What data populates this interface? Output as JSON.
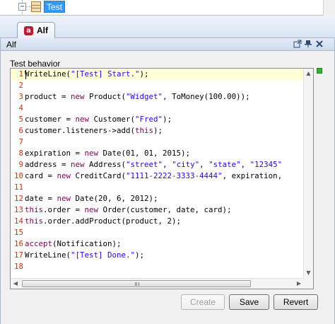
{
  "tree": {
    "expander_symbol": "−",
    "selected_node": "Test"
  },
  "tab": {
    "icon_letter": "a",
    "label": "Alf"
  },
  "panel": {
    "title": "Alf",
    "section_label": "Test behavior"
  },
  "code_lines": [
    {
      "n": "1",
      "parts": [
        [
          "src",
          "WriteLine("
        ],
        [
          "str",
          "\"[Test] Start.\""
        ],
        [
          "src",
          ");"
        ]
      ]
    },
    {
      "n": "2",
      "parts": []
    },
    {
      "n": "3",
      "parts": [
        [
          "src",
          "product = "
        ],
        [
          "kw",
          "new"
        ],
        [
          "src",
          " Product("
        ],
        [
          "str",
          "\"Widget\""
        ],
        [
          "src",
          ", ToMoney(100.00));"
        ]
      ]
    },
    {
      "n": "4",
      "parts": []
    },
    {
      "n": "5",
      "parts": [
        [
          "src",
          "customer = "
        ],
        [
          "kw",
          "new"
        ],
        [
          "src",
          " Customer("
        ],
        [
          "str",
          "\"Fred\""
        ],
        [
          "src",
          ");"
        ]
      ]
    },
    {
      "n": "6",
      "parts": [
        [
          "src",
          "customer.listeners->add("
        ],
        [
          "kw",
          "this"
        ],
        [
          "src",
          ");"
        ]
      ]
    },
    {
      "n": "7",
      "parts": []
    },
    {
      "n": "8",
      "parts": [
        [
          "src",
          "expiration = "
        ],
        [
          "kw",
          "new"
        ],
        [
          "src",
          " Date(01, 01, 2015);"
        ]
      ]
    },
    {
      "n": "9",
      "parts": [
        [
          "src",
          "address = "
        ],
        [
          "kw",
          "new"
        ],
        [
          "src",
          " Address("
        ],
        [
          "str",
          "\"street\""
        ],
        [
          "src",
          ", "
        ],
        [
          "str",
          "\"city\""
        ],
        [
          "src",
          ", "
        ],
        [
          "str",
          "\"state\""
        ],
        [
          "src",
          ", "
        ],
        [
          "str",
          "\"12345\""
        ]
      ]
    },
    {
      "n": "10",
      "parts": [
        [
          "src",
          "card = "
        ],
        [
          "kw",
          "new"
        ],
        [
          "src",
          " CreditCard("
        ],
        [
          "str",
          "\"1111-2222-3333-4444\""
        ],
        [
          "src",
          ", expiration,"
        ]
      ]
    },
    {
      "n": "11",
      "parts": []
    },
    {
      "n": "12",
      "parts": [
        [
          "src",
          "date = "
        ],
        [
          "kw",
          "new"
        ],
        [
          "src",
          " Date(20, 6, 2012);"
        ]
      ]
    },
    {
      "n": "13",
      "parts": [
        [
          "kw",
          "this"
        ],
        [
          "src",
          ".order = "
        ],
        [
          "kw",
          "new"
        ],
        [
          "src",
          " Order(customer, date, card);"
        ]
      ]
    },
    {
      "n": "14",
      "parts": [
        [
          "kw",
          "this"
        ],
        [
          "src",
          ".order.addProduct(product, 2);"
        ]
      ]
    },
    {
      "n": "15",
      "parts": []
    },
    {
      "n": "16",
      "parts": [
        [
          "kw",
          "accept"
        ],
        [
          "src",
          "(Notification);"
        ]
      ]
    },
    {
      "n": "17",
      "parts": [
        [
          "src",
          "WriteLine("
        ],
        [
          "str",
          "\"[Test] Done.\""
        ],
        [
          "src",
          ");"
        ]
      ]
    },
    {
      "n": "18",
      "parts": []
    }
  ],
  "buttons": {
    "create": "Create",
    "save": "Save",
    "revert": "Revert"
  },
  "colors": {
    "keyword": "#7f0055",
    "string": "#2a00ff",
    "line_number": "#cc3300",
    "current_line": "#ffffd6",
    "selection": "#3399ff"
  }
}
